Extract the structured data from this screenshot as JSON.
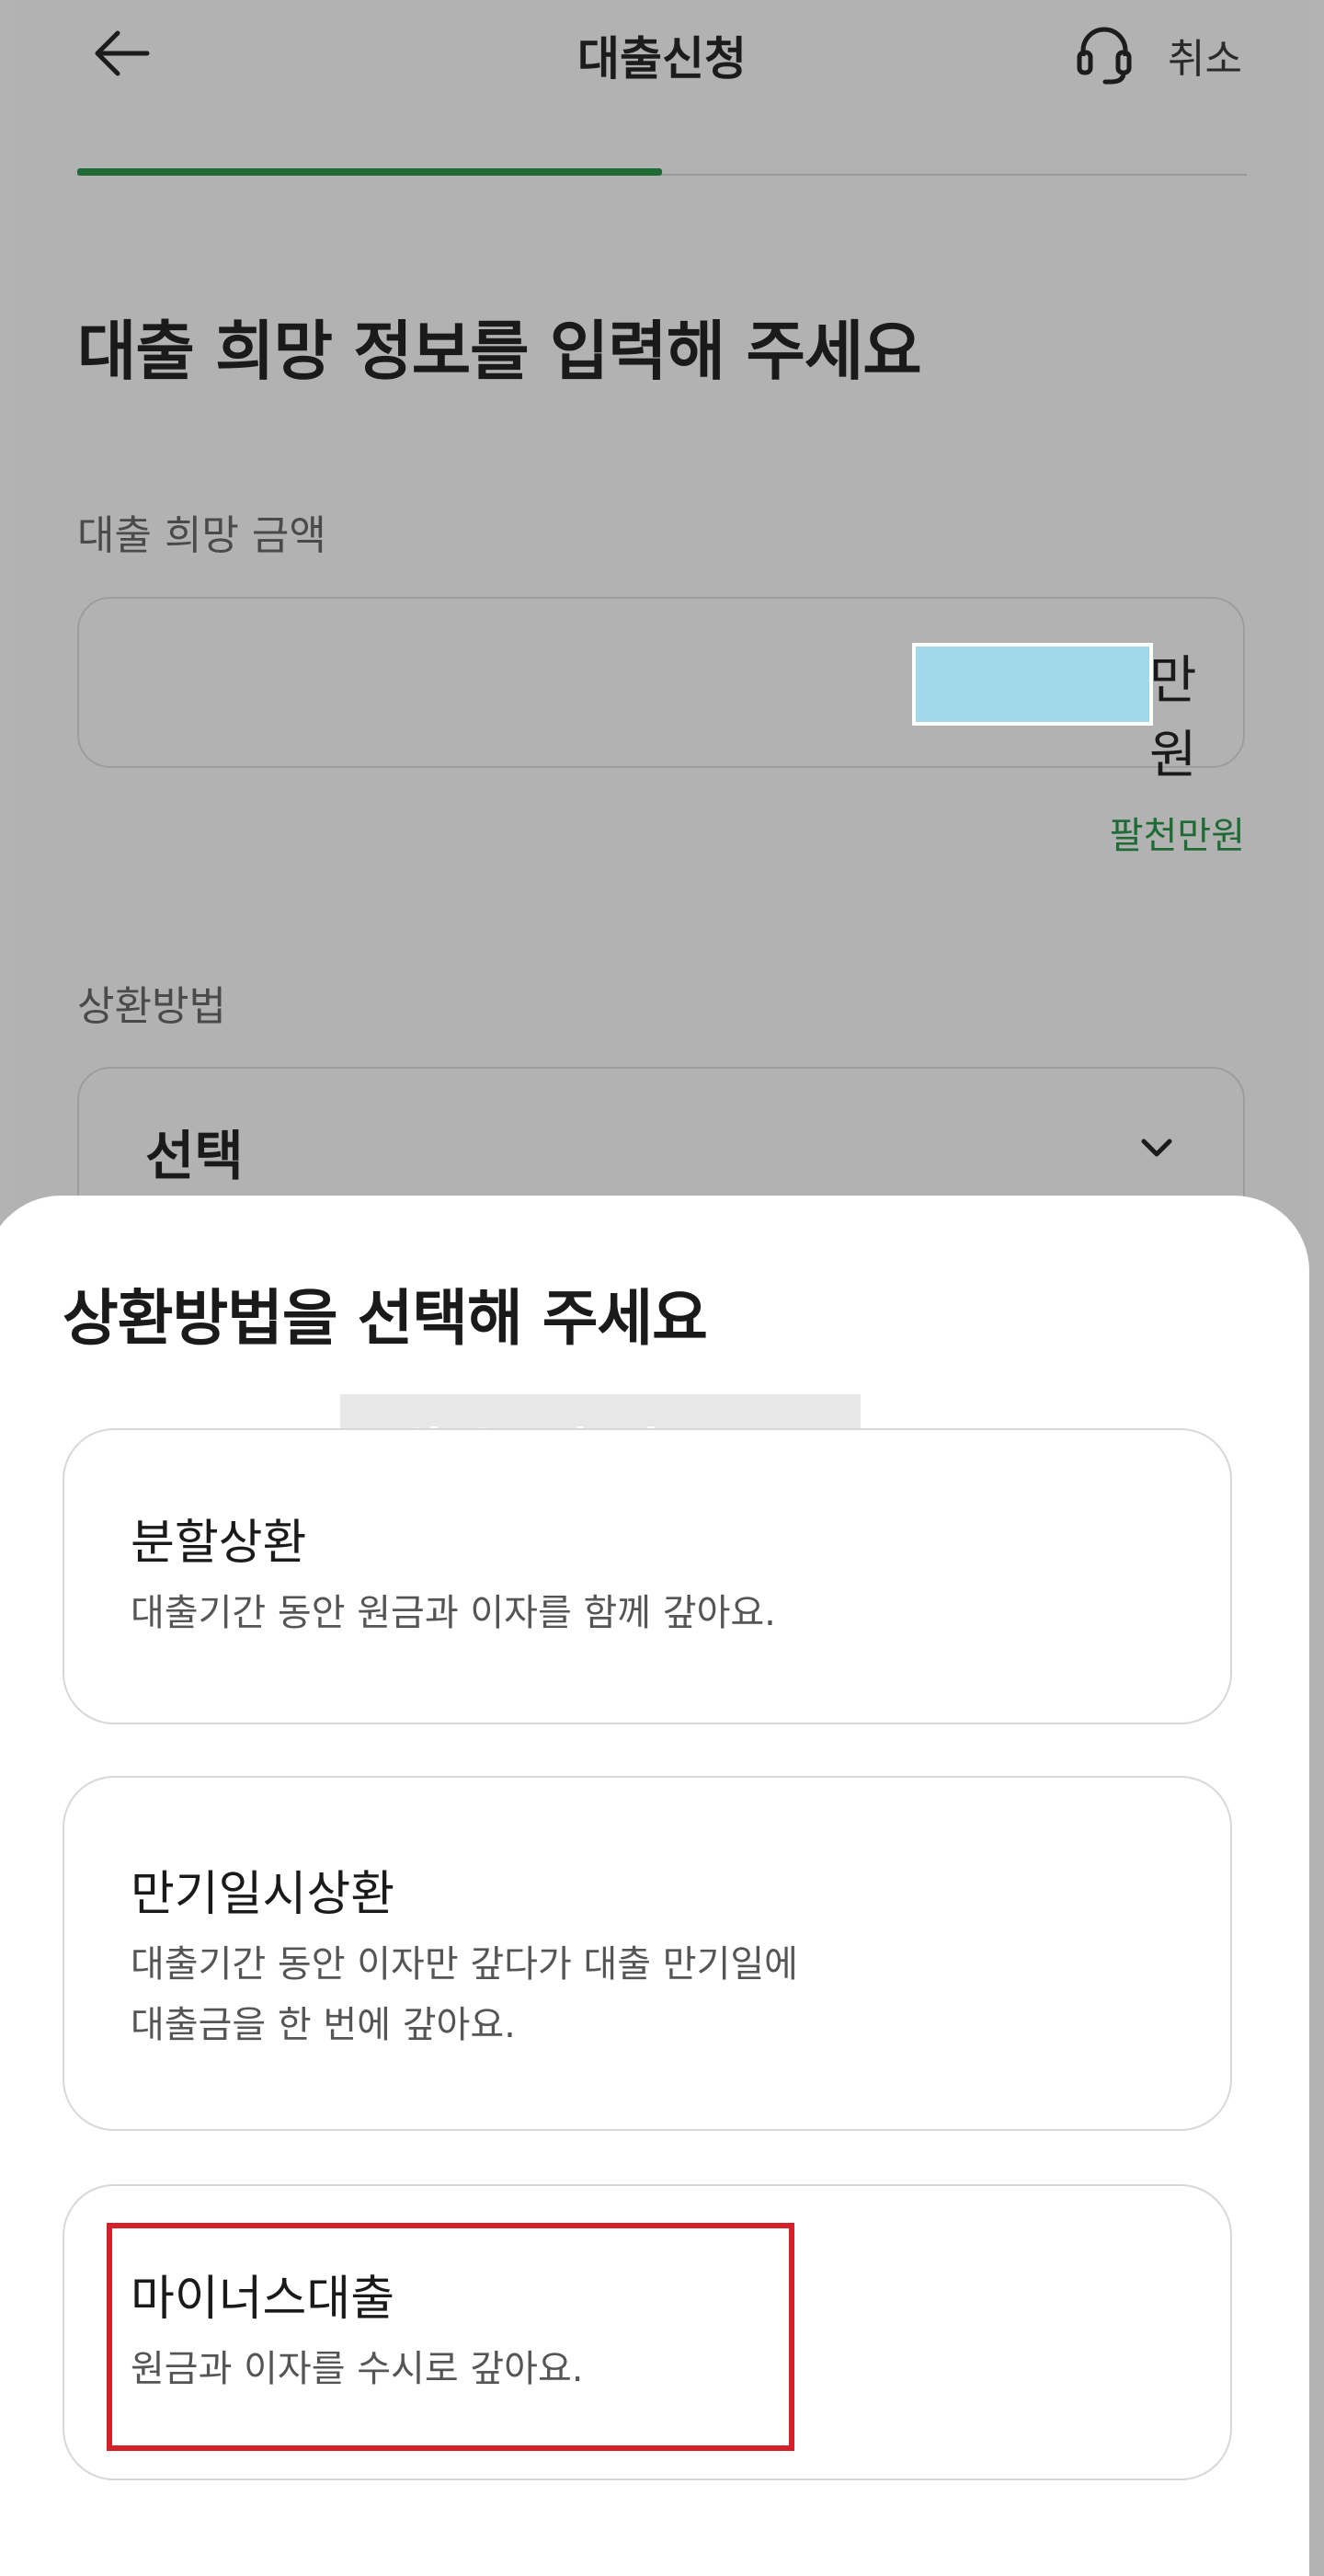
{
  "header": {
    "title": "대출신청",
    "cancel_label": "취소",
    "back_icon": "arrow-left-icon",
    "support_icon": "headset-icon"
  },
  "progress": {
    "fraction": 0.5,
    "color": "#1f6b35"
  },
  "page": {
    "heading": "대출 희망 정보를 입력해 주세요"
  },
  "amount": {
    "label": "대출 희망 금액",
    "unit": "만원",
    "hint": "팔천만원"
  },
  "repayment": {
    "label": "상환방법",
    "value": "선택"
  },
  "sheet": {
    "title": "상환방법을 선택해 주세요",
    "watermark": "새웅지마@@",
    "options": [
      {
        "title": "분할상환",
        "desc_lines": [
          "대출기간 동안 원금과 이자를 함께 갚아요."
        ]
      },
      {
        "title": "만기일시상환",
        "desc_lines": [
          "대출기간 동안 이자만 갚다가 대출 만기일에",
          "대출금을 한 번에 갚아요."
        ]
      },
      {
        "title": "마이너스대출",
        "desc_lines": [
          "원금과 이자를 수시로 갚아요."
        ]
      }
    ]
  },
  "colors": {
    "accent": "#1f6b35",
    "highlight": "#d4202a",
    "overlay": "#b3b3b3",
    "masked_value": "#9ed8e9"
  }
}
